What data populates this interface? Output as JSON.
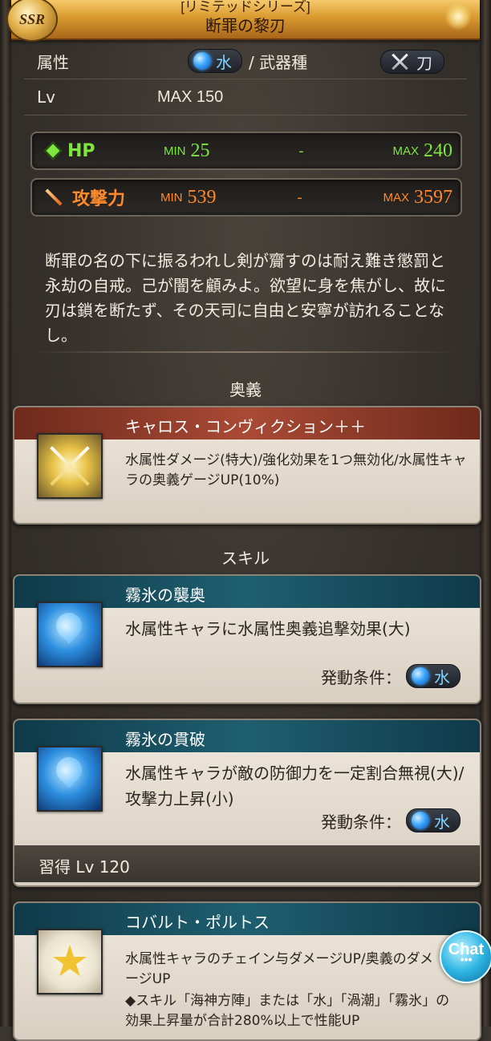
{
  "header": {
    "series": "[リミテッドシリーズ]",
    "title": "断罪の黎刃",
    "rarity": "SSR"
  },
  "attributes": {
    "element_label": "属性",
    "element_value": "水",
    "separator_label": "/ 武器種",
    "weapon_type": "刀",
    "lv_label": "Lv",
    "lv_value": "MAX 150"
  },
  "stats": {
    "hp": {
      "name": "HP",
      "min_label": "MIN",
      "min": "25",
      "dash": "-",
      "max_label": "MAX",
      "max": "240"
    },
    "atk": {
      "name": "攻撃力",
      "min_label": "MIN",
      "min": "539",
      "dash": "-",
      "max_label": "MAX",
      "max": "3597"
    }
  },
  "flavor_text": "断罪の名の下に振るわれし剣が齎すのは耐え難き懲罰と永劫の自戒。己が闇を顧みよ。欲望に身を焦がし、故に刃は鎖を断たず、その天司に自由と安寧が訪れることなし。",
  "ougi": {
    "section_title": "奥義",
    "name": "キャロス・コンヴィクション＋＋",
    "description": "水属性ダメージ(特大)/強化効果を1つ無効化/水属性キャラの奥義ゲージUP(10%)"
  },
  "skills": {
    "section_title": "スキル",
    "condition_label": "発動条件：",
    "condition_value": "水",
    "items": [
      {
        "name": "霧氷の襲奥",
        "description": "水属性キャラに水属性奥義追撃効果(大)"
      },
      {
        "name": "霧氷の貫破",
        "description": "水属性キャラが敵の防御力を一定割合無視(大)/攻撃力上昇(小)",
        "learn": "習得 Lv 120"
      },
      {
        "name": "コバルト・ポルトス",
        "description": "水属性キャラのチェイン与ダメージUP/奥義のダメージUP",
        "note": "◆スキル「海神方陣」または「水」「渦潮」「霧氷」の効果上昇量が合計280%以上で性能UP"
      }
    ]
  },
  "chat": {
    "label": "Chat",
    "dots": "•••"
  },
  "colors": {
    "header_gold": "#d99a2f",
    "hp_green": "#7fe63f",
    "atk_orange": "#ff8a2b",
    "water_blue": "#3aa5ff",
    "ougi_header": "#a94a35",
    "skill_header": "#1f5f70"
  },
  "icons": {
    "rarity": "ssr-badge",
    "element": "water-orb-icon",
    "weapon": "crossed-swords-icon",
    "hp": "hp-diamond-icon",
    "atk": "attack-sword-icon",
    "ougi": "crossed-golden-swords-icon",
    "skill1": "water-drop-icon",
    "skill2": "water-drop-icon",
    "skill3": "star-icon",
    "chat": "chat-bubble-icon"
  }
}
